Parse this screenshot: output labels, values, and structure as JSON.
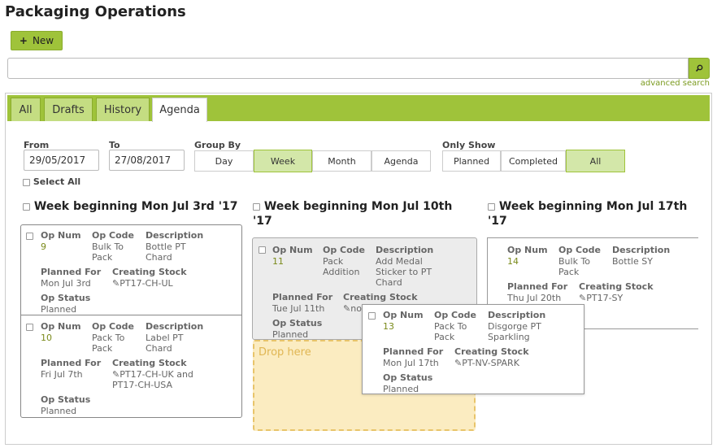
{
  "page": {
    "title": "Packaging Operations"
  },
  "toolbar": {
    "new_label": "New",
    "new_icon": "+"
  },
  "search": {
    "value": "",
    "placeholder": "",
    "advanced_label": "advanced search"
  },
  "tabs": [
    {
      "label": "All",
      "active": false
    },
    {
      "label": "Drafts",
      "active": false
    },
    {
      "label": "History",
      "active": false
    },
    {
      "label": "Agenda",
      "active": true
    }
  ],
  "filters": {
    "from_label": "From",
    "from_value": "29/05/2017",
    "to_label": "To",
    "to_value": "27/08/2017",
    "group_by_label": "Group By",
    "group_by_options": [
      "Day",
      "Week",
      "Month",
      "Agenda"
    ],
    "group_by_selected": "Week",
    "only_show_label": "Only Show",
    "only_show_options": [
      "Planned",
      "Completed",
      "All"
    ],
    "only_show_selected": "All",
    "select_all_label": "Select All"
  },
  "labels": {
    "op_num": "Op Num",
    "op_code": "Op Code",
    "description": "Description",
    "planned_for": "Planned For",
    "creating_stock": "Creating Stock",
    "op_status": "Op Status"
  },
  "weeks": [
    {
      "title": "Week beginning Mon Jul 3rd '17"
    },
    {
      "title": "Week beginning Mon Jul 10th '17"
    },
    {
      "title": "Week beginning Mon Jul 17th '17"
    }
  ],
  "cards": {
    "c9": {
      "op_num": "9",
      "op_code": "Bulk To Pack",
      "description": "Bottle PT Chard",
      "planned_for": "Mon Jul 3rd",
      "creating_stock": "PT17-CH-UL",
      "op_status": "Planned"
    },
    "c10": {
      "op_num": "10",
      "op_code": "Pack To Pack",
      "description": "Label PT Chard",
      "planned_for": "Fri Jul 7th",
      "creating_stock": "PT17-CH-UK and PT17-CH-USA",
      "op_status": "Planned"
    },
    "c11": {
      "op_num": "11",
      "op_code": "Pack Addition",
      "description": "Add Medal Sticker to PT Chard",
      "planned_for": "Tue Jul 11th",
      "creating_stock": "non",
      "op_status": "Planned"
    },
    "c14": {
      "op_num": "14",
      "op_code": "Bulk To Pack",
      "description": "Bottle SY",
      "planned_for": "Thu Jul 20th",
      "creating_stock": "PT17-SY"
    },
    "c13": {
      "op_num": "13",
      "op_code": "Pack To Pack",
      "description": "Disgorge PT Sparkling",
      "planned_for": "Mon Jul 17th",
      "creating_stock": "PT-NV-SPARK",
      "op_status": "Planned"
    }
  },
  "drop_zone": {
    "label": "Drop here"
  },
  "colors": {
    "accent": "#9fc33a",
    "selected_segment": "#d3e7a9",
    "drop_zone": "#fbecc1",
    "op_num": "#7a8a1a"
  }
}
